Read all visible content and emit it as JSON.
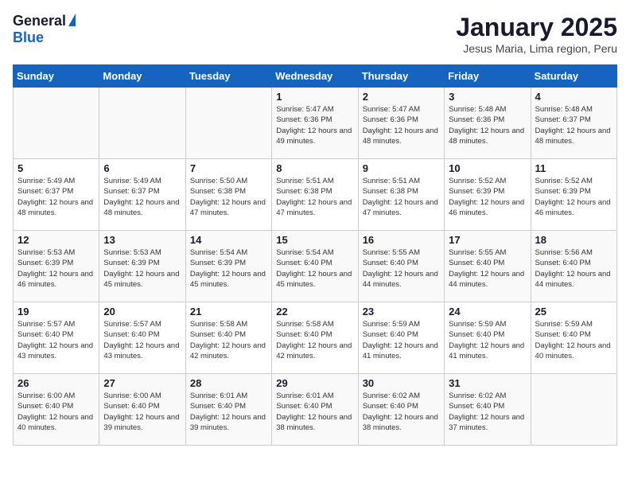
{
  "logo": {
    "general": "General",
    "blue": "Blue"
  },
  "header": {
    "title": "January 2025",
    "subtitle": "Jesus Maria, Lima region, Peru"
  },
  "days_of_week": [
    "Sunday",
    "Monday",
    "Tuesday",
    "Wednesday",
    "Thursday",
    "Friday",
    "Saturday"
  ],
  "weeks": [
    [
      {
        "day": "",
        "sunrise": "",
        "sunset": "",
        "daylight": ""
      },
      {
        "day": "",
        "sunrise": "",
        "sunset": "",
        "daylight": ""
      },
      {
        "day": "",
        "sunrise": "",
        "sunset": "",
        "daylight": ""
      },
      {
        "day": "1",
        "sunrise": "Sunrise: 5:47 AM",
        "sunset": "Sunset: 6:36 PM",
        "daylight": "Daylight: 12 hours and 49 minutes."
      },
      {
        "day": "2",
        "sunrise": "Sunrise: 5:47 AM",
        "sunset": "Sunset: 6:36 PM",
        "daylight": "Daylight: 12 hours and 48 minutes."
      },
      {
        "day": "3",
        "sunrise": "Sunrise: 5:48 AM",
        "sunset": "Sunset: 6:36 PM",
        "daylight": "Daylight: 12 hours and 48 minutes."
      },
      {
        "day": "4",
        "sunrise": "Sunrise: 5:48 AM",
        "sunset": "Sunset: 6:37 PM",
        "daylight": "Daylight: 12 hours and 48 minutes."
      }
    ],
    [
      {
        "day": "5",
        "sunrise": "Sunrise: 5:49 AM",
        "sunset": "Sunset: 6:37 PM",
        "daylight": "Daylight: 12 hours and 48 minutes."
      },
      {
        "day": "6",
        "sunrise": "Sunrise: 5:49 AM",
        "sunset": "Sunset: 6:37 PM",
        "daylight": "Daylight: 12 hours and 48 minutes."
      },
      {
        "day": "7",
        "sunrise": "Sunrise: 5:50 AM",
        "sunset": "Sunset: 6:38 PM",
        "daylight": "Daylight: 12 hours and 47 minutes."
      },
      {
        "day": "8",
        "sunrise": "Sunrise: 5:51 AM",
        "sunset": "Sunset: 6:38 PM",
        "daylight": "Daylight: 12 hours and 47 minutes."
      },
      {
        "day": "9",
        "sunrise": "Sunrise: 5:51 AM",
        "sunset": "Sunset: 6:38 PM",
        "daylight": "Daylight: 12 hours and 47 minutes."
      },
      {
        "day": "10",
        "sunrise": "Sunrise: 5:52 AM",
        "sunset": "Sunset: 6:39 PM",
        "daylight": "Daylight: 12 hours and 46 minutes."
      },
      {
        "day": "11",
        "sunrise": "Sunrise: 5:52 AM",
        "sunset": "Sunset: 6:39 PM",
        "daylight": "Daylight: 12 hours and 46 minutes."
      }
    ],
    [
      {
        "day": "12",
        "sunrise": "Sunrise: 5:53 AM",
        "sunset": "Sunset: 6:39 PM",
        "daylight": "Daylight: 12 hours and 46 minutes."
      },
      {
        "day": "13",
        "sunrise": "Sunrise: 5:53 AM",
        "sunset": "Sunset: 6:39 PM",
        "daylight": "Daylight: 12 hours and 45 minutes."
      },
      {
        "day": "14",
        "sunrise": "Sunrise: 5:54 AM",
        "sunset": "Sunset: 6:39 PM",
        "daylight": "Daylight: 12 hours and 45 minutes."
      },
      {
        "day": "15",
        "sunrise": "Sunrise: 5:54 AM",
        "sunset": "Sunset: 6:40 PM",
        "daylight": "Daylight: 12 hours and 45 minutes."
      },
      {
        "day": "16",
        "sunrise": "Sunrise: 5:55 AM",
        "sunset": "Sunset: 6:40 PM",
        "daylight": "Daylight: 12 hours and 44 minutes."
      },
      {
        "day": "17",
        "sunrise": "Sunrise: 5:55 AM",
        "sunset": "Sunset: 6:40 PM",
        "daylight": "Daylight: 12 hours and 44 minutes."
      },
      {
        "day": "18",
        "sunrise": "Sunrise: 5:56 AM",
        "sunset": "Sunset: 6:40 PM",
        "daylight": "Daylight: 12 hours and 44 minutes."
      }
    ],
    [
      {
        "day": "19",
        "sunrise": "Sunrise: 5:57 AM",
        "sunset": "Sunset: 6:40 PM",
        "daylight": "Daylight: 12 hours and 43 minutes."
      },
      {
        "day": "20",
        "sunrise": "Sunrise: 5:57 AM",
        "sunset": "Sunset: 6:40 PM",
        "daylight": "Daylight: 12 hours and 43 minutes."
      },
      {
        "day": "21",
        "sunrise": "Sunrise: 5:58 AM",
        "sunset": "Sunset: 6:40 PM",
        "daylight": "Daylight: 12 hours and 42 minutes."
      },
      {
        "day": "22",
        "sunrise": "Sunrise: 5:58 AM",
        "sunset": "Sunset: 6:40 PM",
        "daylight": "Daylight: 12 hours and 42 minutes."
      },
      {
        "day": "23",
        "sunrise": "Sunrise: 5:59 AM",
        "sunset": "Sunset: 6:40 PM",
        "daylight": "Daylight: 12 hours and 41 minutes."
      },
      {
        "day": "24",
        "sunrise": "Sunrise: 5:59 AM",
        "sunset": "Sunset: 6:40 PM",
        "daylight": "Daylight: 12 hours and 41 minutes."
      },
      {
        "day": "25",
        "sunrise": "Sunrise: 5:59 AM",
        "sunset": "Sunset: 6:40 PM",
        "daylight": "Daylight: 12 hours and 40 minutes."
      }
    ],
    [
      {
        "day": "26",
        "sunrise": "Sunrise: 6:00 AM",
        "sunset": "Sunset: 6:40 PM",
        "daylight": "Daylight: 12 hours and 40 minutes."
      },
      {
        "day": "27",
        "sunrise": "Sunrise: 6:00 AM",
        "sunset": "Sunset: 6:40 PM",
        "daylight": "Daylight: 12 hours and 39 minutes."
      },
      {
        "day": "28",
        "sunrise": "Sunrise: 6:01 AM",
        "sunset": "Sunset: 6:40 PM",
        "daylight": "Daylight: 12 hours and 39 minutes."
      },
      {
        "day": "29",
        "sunrise": "Sunrise: 6:01 AM",
        "sunset": "Sunset: 6:40 PM",
        "daylight": "Daylight: 12 hours and 38 minutes."
      },
      {
        "day": "30",
        "sunrise": "Sunrise: 6:02 AM",
        "sunset": "Sunset: 6:40 PM",
        "daylight": "Daylight: 12 hours and 38 minutes."
      },
      {
        "day": "31",
        "sunrise": "Sunrise: 6:02 AM",
        "sunset": "Sunset: 6:40 PM",
        "daylight": "Daylight: 12 hours and 37 minutes."
      },
      {
        "day": "",
        "sunrise": "",
        "sunset": "",
        "daylight": ""
      }
    ]
  ]
}
